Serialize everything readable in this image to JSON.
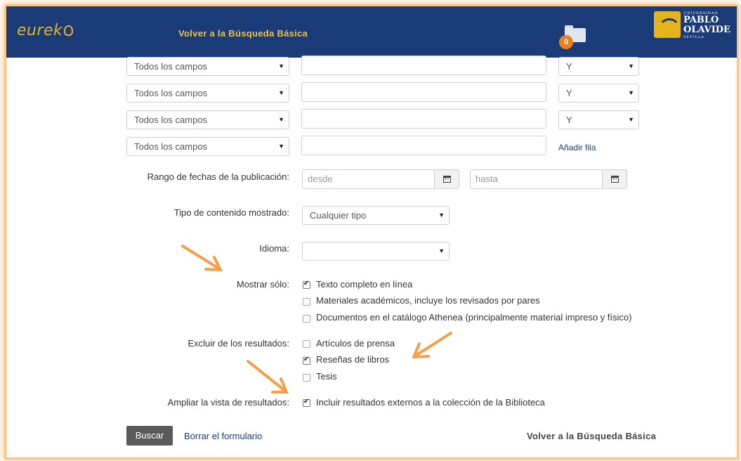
{
  "header": {
    "logo_text": "eurek",
    "back_link": "Volver a la Búsqueda Básica",
    "folder_count": "0",
    "university": {
      "line1": "UNIVERSIDAD",
      "line2": "PABLO",
      "line3": "OLAVIDE",
      "line4": "SEVILLA"
    }
  },
  "search_rows": [
    {
      "field": "Todos los campos",
      "value": "",
      "operator": "Y"
    },
    {
      "field": "Todos los campos",
      "value": "",
      "operator": "Y"
    },
    {
      "field": "Todos los campos",
      "value": "",
      "operator": "Y"
    },
    {
      "field": "Todos los campos",
      "value": ""
    }
  ],
  "add_row_label": "Añadir fila",
  "date_range": {
    "label": "Rango de fechas de la publicación:",
    "from_placeholder": "desde",
    "to_placeholder": "hasta"
  },
  "content_type": {
    "label": "Tipo de contenido mostrado:",
    "value": "Cualquier tipo"
  },
  "language": {
    "label": "Idioma:",
    "value": ""
  },
  "show_only": {
    "label": "Mostrar sólo:",
    "options": [
      {
        "label": "Texto completo en línea",
        "checked": true
      },
      {
        "label": "Materiales académicos, incluye los revisados por pares",
        "checked": false
      },
      {
        "label": "Documentos en el catálogo Athenea (principalmente material impreso y físico)",
        "checked": false
      }
    ]
  },
  "exclude": {
    "label": "Excluir de los resultados:",
    "options": [
      {
        "label": "Artículos de prensa",
        "checked": false
      },
      {
        "label": "Reseñas de libros",
        "checked": true
      },
      {
        "label": "Tesis",
        "checked": false
      }
    ]
  },
  "expand": {
    "label": "Ampliar la vista de resultados:",
    "options": [
      {
        "label": "Incluir resultados externos a la colección de la Biblioteca",
        "checked": true
      }
    ]
  },
  "footer": {
    "search_button": "Buscar",
    "clear_link": "Borrar el formulario",
    "back_link": "Volver a la Búsqueda Básica"
  },
  "colors": {
    "header_bg": "#1b3a78",
    "accent_yellow": "#e3b51b",
    "annotation_orange": "#f4a04a",
    "badge_orange": "#e8811a"
  }
}
